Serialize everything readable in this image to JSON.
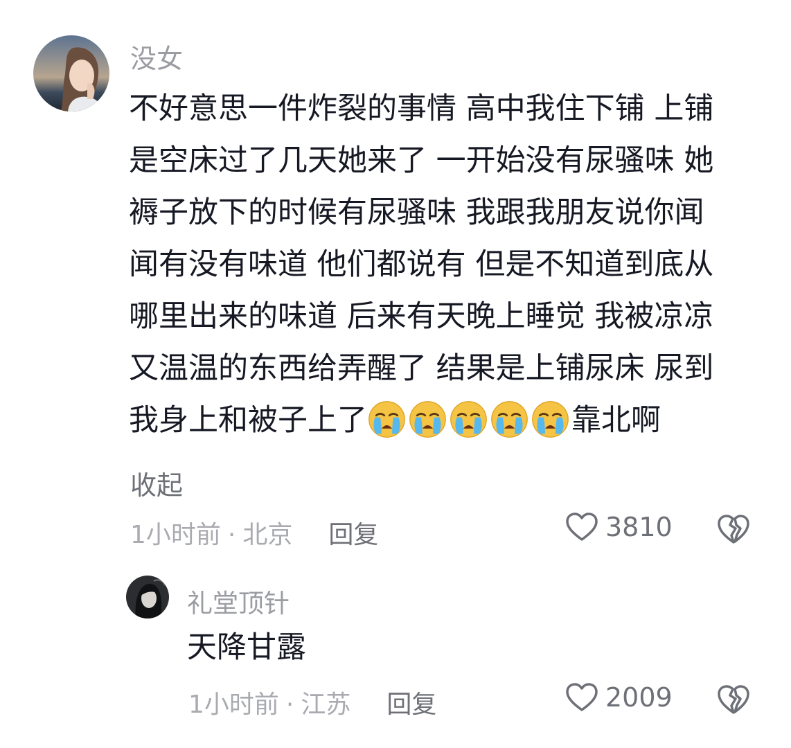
{
  "comments": [
    {
      "username": "没女",
      "content_lines": [
        "不好意思一件炸裂的事情 高中我住下铺 上铺",
        "是空床过了几天她来了 一开始没有尿骚味 她",
        "褥子放下的时候有尿骚味 我跟我朋友说你闻",
        "闻有没有味道 他们都说有 但是不知道到底从",
        "哪里出来的味道 后来有天晚上睡觉 我被凉凉",
        "又温温的东西给弄醒了 结果是上铺尿床 尿到"
      ],
      "last_line_prefix": "我身上和被子上了",
      "emoji_name": "crying-face-emoji",
      "emoji_count": 5,
      "last_line_suffix": "靠北啊",
      "collapse_label": "收起",
      "time": "1小时前",
      "separator": "·",
      "location": "北京",
      "reply_label": "回复",
      "like_count": "3810",
      "like_icon": "heart-outline-icon",
      "dislike_icon": "broken-heart-icon"
    },
    {
      "username": "礼堂顶针",
      "content_lines": [
        "天降甘露"
      ],
      "time": "1小时前",
      "separator": "·",
      "location": "江苏",
      "reply_label": "回复",
      "like_count": "2009",
      "like_icon": "heart-outline-icon",
      "dislike_icon": "broken-heart-icon"
    }
  ],
  "colors": {
    "text_primary": "#161823",
    "text_secondary": "#9a9ca1",
    "text_meta": "#a9abb0",
    "icon": "#6e7077"
  }
}
